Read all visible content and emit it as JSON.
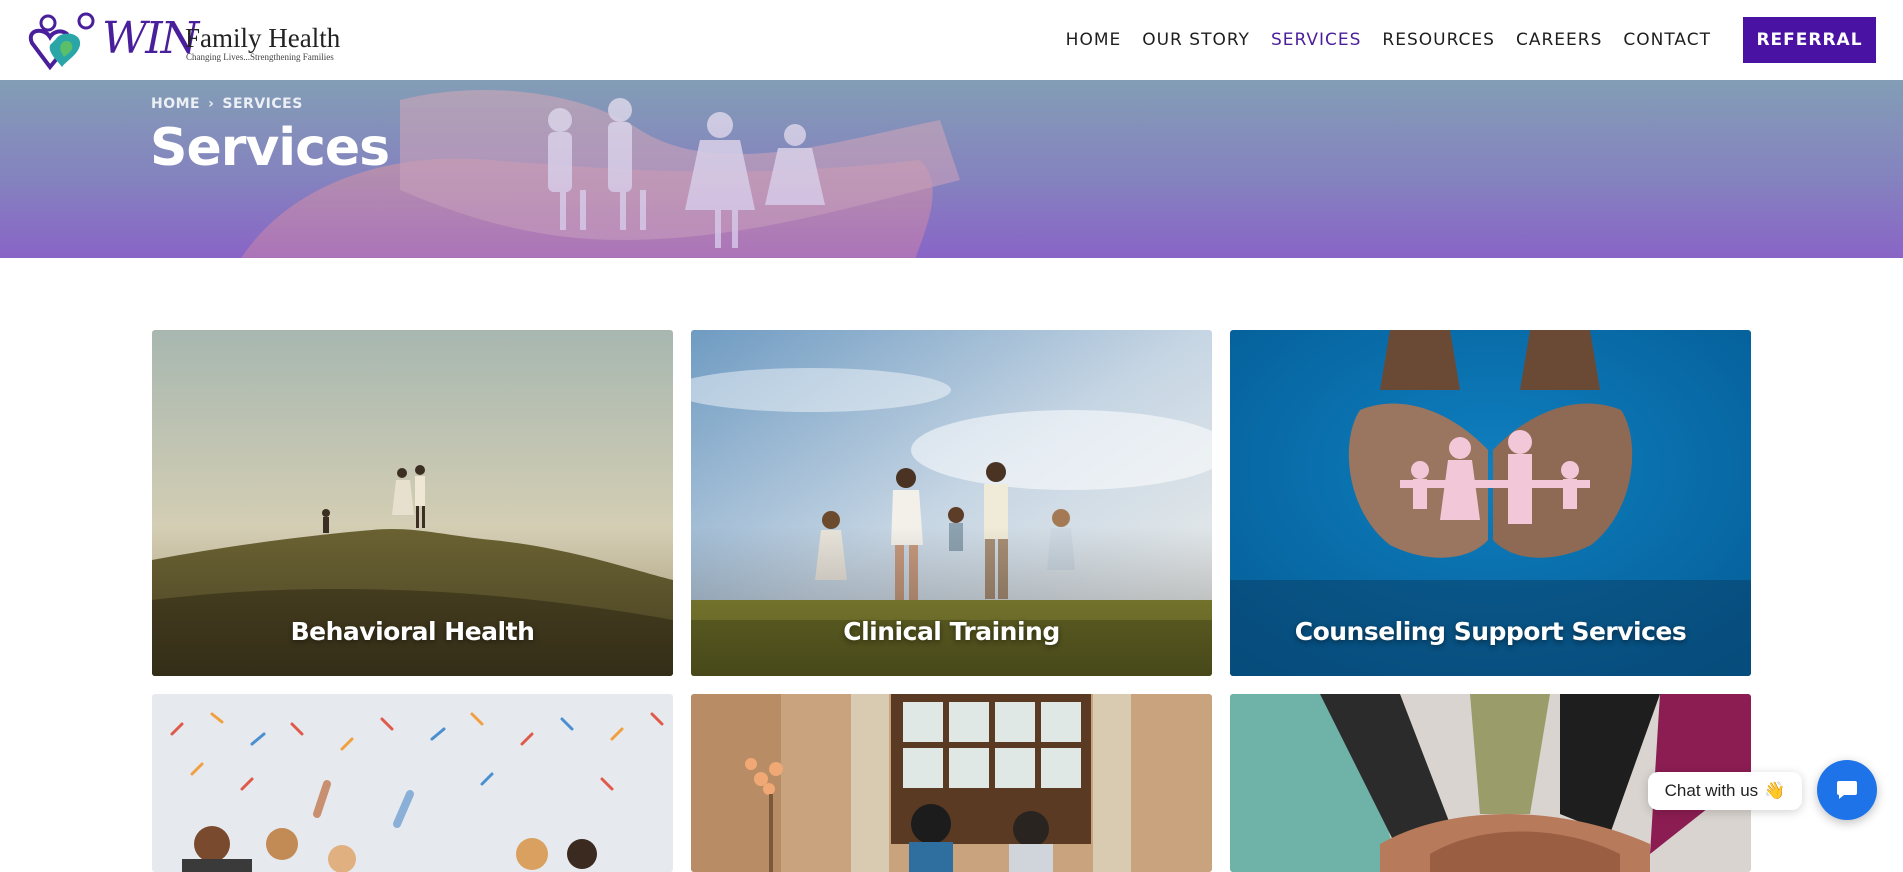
{
  "brand": {
    "logo_mark": "WIN",
    "name": "Family Health",
    "tagline": "Changing Lives...Strengthening Families",
    "accent_color": "#4a12a3"
  },
  "nav": {
    "items": [
      {
        "label": "HOME",
        "active": false
      },
      {
        "label": "OUR STORY",
        "active": false
      },
      {
        "label": "SERVICES",
        "active": true
      },
      {
        "label": "RESOURCES",
        "active": false
      },
      {
        "label": "CAREERS",
        "active": false
      },
      {
        "label": "CONTACT",
        "active": false
      }
    ],
    "cta_label": "REFERRAL"
  },
  "hero": {
    "breadcrumb": [
      "HOME",
      "SERVICES"
    ],
    "title": "Services"
  },
  "cards": [
    {
      "title": "Behavioral Health",
      "image": "family-on-hill-sunset"
    },
    {
      "title": "Clinical Training",
      "image": "family-running-field"
    },
    {
      "title": "Counseling Support Services",
      "image": "hands-holding-paper-family"
    },
    {
      "title": "",
      "image": "kids-confetti"
    },
    {
      "title": "",
      "image": "couple-consultation-room"
    },
    {
      "title": "",
      "image": "group-hands-stacked"
    }
  ],
  "chat": {
    "bubble_text": "Chat with us",
    "bubble_emoji": "👋",
    "button_icon": "chat-icon",
    "button_color": "#1e73e8"
  }
}
